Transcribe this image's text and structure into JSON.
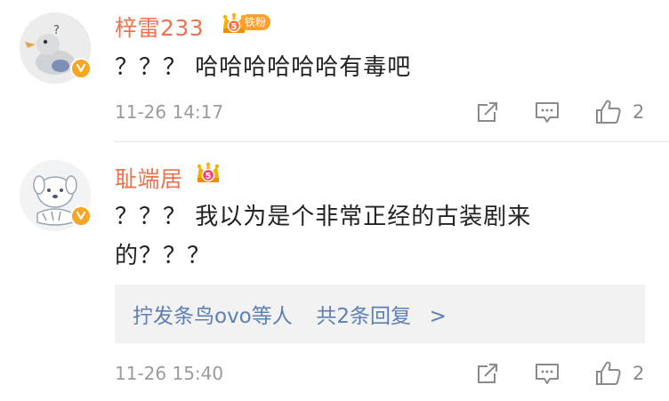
{
  "comments": [
    {
      "username": "梓雷233",
      "fan_tag": "铁粉",
      "badge_level": "5",
      "text": "？？？ 哈哈哈哈哈哈有毒吧",
      "time": "11-26 14:17",
      "likes": "2"
    },
    {
      "username": "耻端居",
      "badge_level": "5",
      "text_line1": "？？？ 我以为是个非常正经的古装剧来",
      "text_line2": "的？？？",
      "replies": {
        "names": "拧发条鸟ovo等人",
        "summary": "共2条回复",
        "arrow": ">"
      },
      "time": "11-26 15:40",
      "likes": "2"
    }
  ],
  "colors": {
    "username": "#eb7350",
    "link": "#5d7fb1",
    "meta": "#9b9b9b",
    "verified": "#f6a623"
  },
  "icons": [
    "avatar-duck",
    "avatar-seal",
    "verified-badge-icon",
    "crown-badge-icon",
    "share-icon",
    "comment-icon",
    "like-icon"
  ]
}
